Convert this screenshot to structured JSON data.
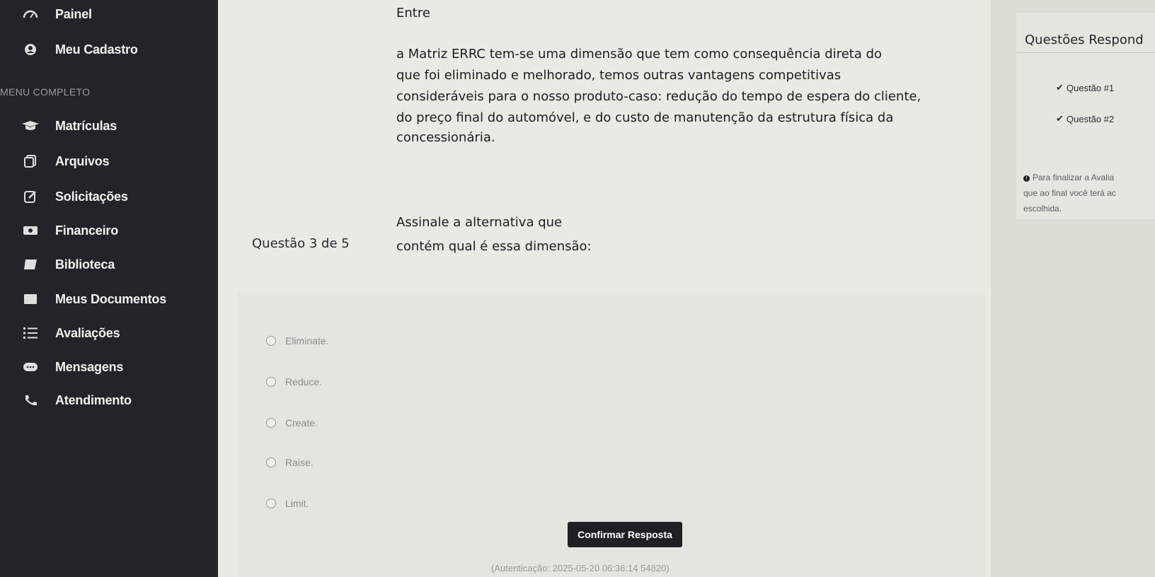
{
  "sidebar": {
    "items": [
      {
        "label": "Painel",
        "icon": "dashboard-icon"
      },
      {
        "label": "Meu Cadastro",
        "icon": "user-icon"
      },
      {
        "label": "Matrículas",
        "icon": "graduation-cap-icon"
      },
      {
        "label": "Arquivos",
        "icon": "files-icon"
      },
      {
        "label": "Solicitações",
        "icon": "edit-icon"
      },
      {
        "label": "Financeiro",
        "icon": "money-icon"
      },
      {
        "label": "Biblioteca",
        "icon": "book-icon"
      },
      {
        "label": "Meus Documentos",
        "icon": "folder-icon"
      },
      {
        "label": "Avaliações",
        "icon": "list-icon"
      },
      {
        "label": "Mensagens",
        "icon": "chat-icon"
      },
      {
        "label": "Atendimento",
        "icon": "phone-icon"
      }
    ],
    "section_label": "MENU COMPLETO"
  },
  "question": {
    "number": "Questão 3 de 5",
    "lines": [
      "Entre",
      "a Matriz ERRC tem-se uma dimensão que tem como consequência direta do",
      "que foi eliminado e melhorado, temos outras vantagens competitivas",
      "consideráveis para o nosso produto-caso: redução do tempo de espera do cliente,",
      "do preço final do automóvel, e do custo de manutenção da estrutura física da",
      "concessionária.",
      "Assinale a alternativa que",
      "contém qual é essa dimensão:"
    ],
    "options": [
      "Eliminate.",
      "Reduce.",
      "Create.",
      "Raise.",
      "Limit."
    ],
    "confirm_label": "Confirmar Resposta",
    "auth_text": "(Autenticação: 2025-05-20 06:36:14 54820)"
  },
  "right_panel": {
    "title": "Questões Respond",
    "answered": [
      "Questão #1",
      "Questão #2"
    ],
    "note_lines": [
      "Para finalizar a Avalia",
      "que ao final você terá ac",
      "escolhida."
    ]
  },
  "colors": {
    "sidebar_bg": "#23242a",
    "content_bg": "#e9eae4",
    "button_bg": "#1f2024"
  }
}
